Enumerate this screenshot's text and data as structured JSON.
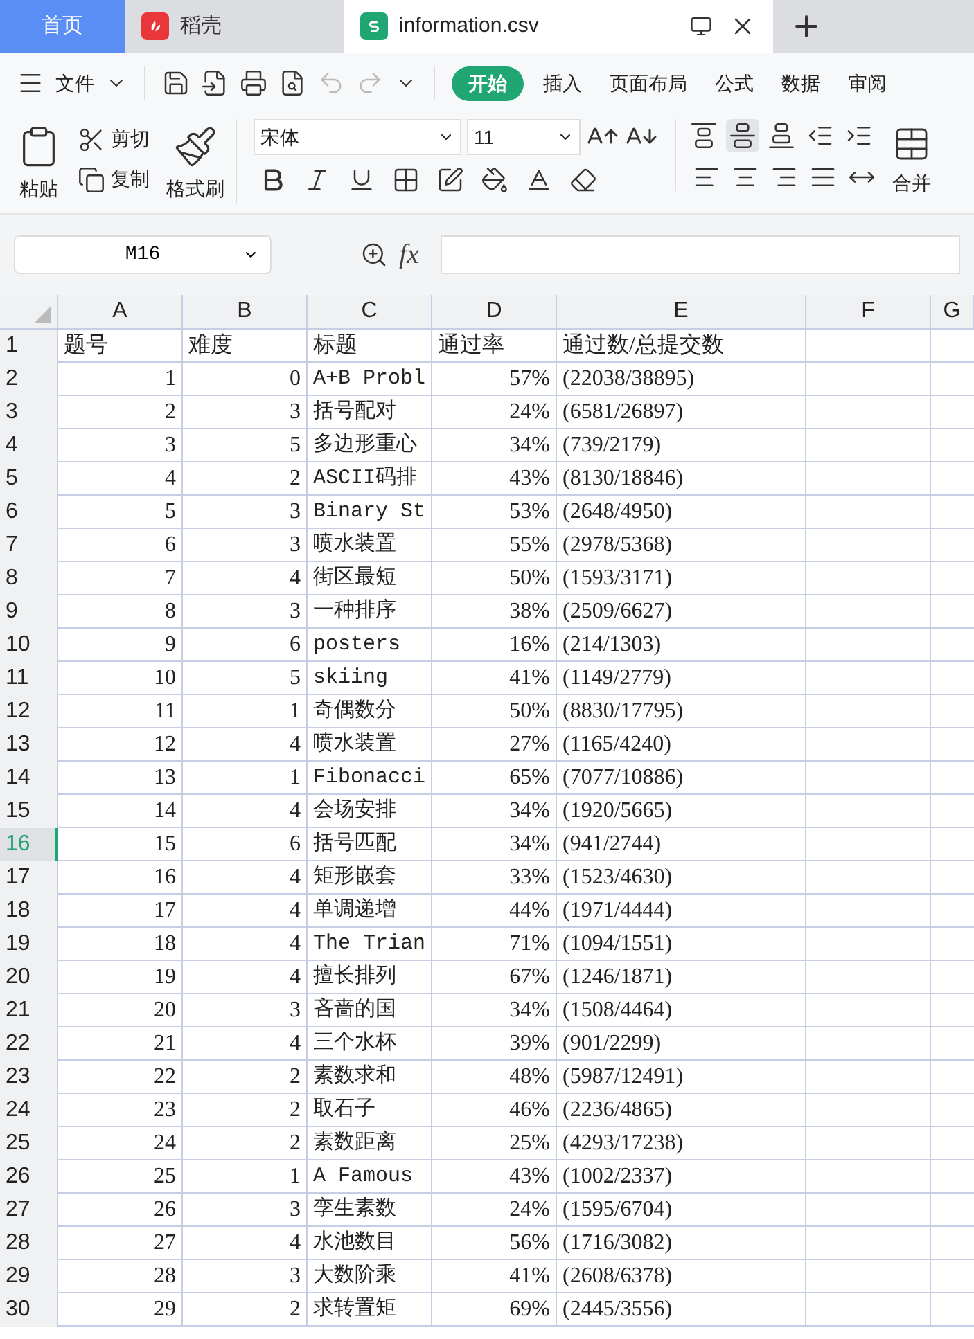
{
  "window_tabs": [
    {
      "label": "首页",
      "kind": "home",
      "selected": false
    },
    {
      "label": "稻壳",
      "kind": "docer",
      "selected": false
    },
    {
      "label": "information.csv",
      "kind": "sheet",
      "selected": true
    }
  ],
  "menu": {
    "file": "文件",
    "tabs": [
      {
        "label": "开始",
        "selected": true
      },
      {
        "label": "插入",
        "selected": false
      },
      {
        "label": "页面布局",
        "selected": false
      },
      {
        "label": "公式",
        "selected": false
      },
      {
        "label": "数据",
        "selected": false
      },
      {
        "label": "审阅",
        "selected": false
      }
    ]
  },
  "ribbon": {
    "paste": "粘贴",
    "cut": "剪切",
    "copy": "复制",
    "format_painter": "格式刷",
    "font_name": "宋体",
    "font_size": "11",
    "merge": "合并",
    "align_buttons": [
      {
        "selected": false
      },
      {
        "selected": true
      },
      {
        "selected": false
      },
      {
        "selected": false
      },
      {
        "selected": false
      }
    ]
  },
  "formula_bar": {
    "name_box": "M16",
    "fx": "fx"
  },
  "columns": [
    "A",
    "B",
    "C",
    "D",
    "E",
    "F",
    "G"
  ],
  "rows": [
    {
      "n": "1",
      "selected": false,
      "cells": [
        "题号",
        "难度",
        "标题",
        "通过率",
        "通过数/总提交数"
      ]
    },
    {
      "n": "2",
      "selected": false,
      "cells": [
        "1",
        "0",
        "A+B Probl",
        "57%",
        "(22038/38895)"
      ]
    },
    {
      "n": "3",
      "selected": false,
      "cells": [
        "2",
        "3",
        "括号配对",
        "24%",
        "(6581/26897)"
      ]
    },
    {
      "n": "4",
      "selected": false,
      "cells": [
        "3",
        "5",
        "多边形重心",
        "34%",
        "(739/2179)"
      ]
    },
    {
      "n": "5",
      "selected": false,
      "cells": [
        "4",
        "2",
        "ASCII码排",
        "43%",
        "(8130/18846)"
      ]
    },
    {
      "n": "6",
      "selected": false,
      "cells": [
        "5",
        "3",
        "Binary St",
        "53%",
        "(2648/4950)"
      ]
    },
    {
      "n": "7",
      "selected": false,
      "cells": [
        "6",
        "3",
        "喷水装置",
        "55%",
        "(2978/5368)"
      ]
    },
    {
      "n": "8",
      "selected": false,
      "cells": [
        "7",
        "4",
        "街区最短",
        "50%",
        "(1593/3171)"
      ]
    },
    {
      "n": "9",
      "selected": false,
      "cells": [
        "8",
        "3",
        "一种排序",
        "38%",
        "(2509/6627)"
      ]
    },
    {
      "n": "10",
      "selected": false,
      "cells": [
        "9",
        "6",
        "posters",
        "16%",
        "(214/1303)"
      ]
    },
    {
      "n": "11",
      "selected": false,
      "cells": [
        "10",
        "5",
        "skiing",
        "41%",
        "(1149/2779)"
      ]
    },
    {
      "n": "12",
      "selected": false,
      "cells": [
        "11",
        "1",
        "奇偶数分",
        "50%",
        "(8830/17795)"
      ]
    },
    {
      "n": "13",
      "selected": false,
      "cells": [
        "12",
        "4",
        "喷水装置",
        "27%",
        "(1165/4240)"
      ]
    },
    {
      "n": "14",
      "selected": false,
      "cells": [
        "13",
        "1",
        "Fibonacci",
        "65%",
        "(7077/10886)"
      ]
    },
    {
      "n": "15",
      "selected": false,
      "cells": [
        "14",
        "4",
        "会场安排",
        "34%",
        "(1920/5665)"
      ]
    },
    {
      "n": "16",
      "selected": true,
      "cells": [
        "15",
        "6",
        "括号匹配",
        "34%",
        "(941/2744)"
      ]
    },
    {
      "n": "17",
      "selected": false,
      "cells": [
        "16",
        "4",
        "矩形嵌套",
        "33%",
        "(1523/4630)"
      ]
    },
    {
      "n": "18",
      "selected": false,
      "cells": [
        "17",
        "4",
        "单调递增",
        "44%",
        "(1971/4444)"
      ]
    },
    {
      "n": "19",
      "selected": false,
      "cells": [
        "18",
        "4",
        "The Trian",
        "71%",
        "(1094/1551)"
      ]
    },
    {
      "n": "20",
      "selected": false,
      "cells": [
        "19",
        "4",
        "擅长排列",
        "67%",
        "(1246/1871)"
      ]
    },
    {
      "n": "21",
      "selected": false,
      "cells": [
        "20",
        "3",
        "吝啬的国",
        "34%",
        "(1508/4464)"
      ]
    },
    {
      "n": "22",
      "selected": false,
      "cells": [
        "21",
        "4",
        "三个水杯",
        "39%",
        "(901/2299)"
      ]
    },
    {
      "n": "23",
      "selected": false,
      "cells": [
        "22",
        "2",
        "素数求和",
        "48%",
        "(5987/12491)"
      ]
    },
    {
      "n": "24",
      "selected": false,
      "cells": [
        "23",
        "2",
        "取石子",
        "46%",
        "(2236/4865)"
      ]
    },
    {
      "n": "25",
      "selected": false,
      "cells": [
        "24",
        "2",
        "素数距离",
        "25%",
        "(4293/17238)"
      ]
    },
    {
      "n": "26",
      "selected": false,
      "cells": [
        "25",
        "1",
        "A Famous",
        "43%",
        "(1002/2337)"
      ]
    },
    {
      "n": "27",
      "selected": false,
      "cells": [
        "26",
        "3",
        "孪生素数",
        "24%",
        "(1595/6704)"
      ]
    },
    {
      "n": "28",
      "selected": false,
      "cells": [
        "27",
        "4",
        "水池数目",
        "56%",
        "(1716/3082)"
      ]
    },
    {
      "n": "29",
      "selected": false,
      "cells": [
        "28",
        "3",
        "大数阶乘",
        "41%",
        "(2608/6378)"
      ]
    },
    {
      "n": "30",
      "selected": false,
      "cells": [
        "29",
        "2",
        "求转置矩",
        "69%",
        "(2445/3556)"
      ]
    }
  ]
}
